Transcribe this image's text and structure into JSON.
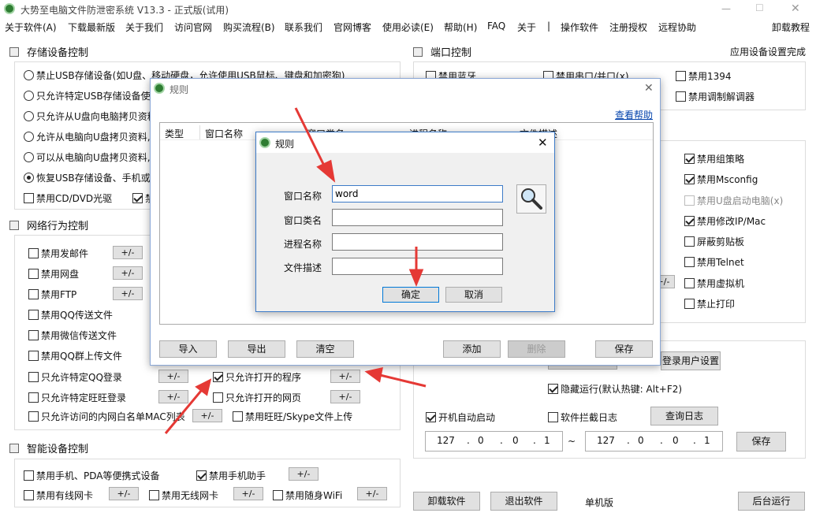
{
  "title": "大势至电脑文件防泄密系统 V13.3 - 正式版(试用)",
  "menu": [
    "关于软件(A)",
    "下载最新版",
    "关于我们",
    "访问官网",
    "购买流程(B)",
    "联系我们",
    "官网博客",
    "使用必读(E)",
    "帮助(H)",
    "FAQ",
    "关于",
    "|",
    "操作软件",
    "注册授权",
    "远程协助"
  ],
  "menu_right": "卸载教程",
  "storage": {
    "title": "存储设备控制",
    "options": [
      "禁止USB存储设备(如U盘、移动硬盘，允许使用USB鼠标、键盘和加密狗)",
      "只允许特定USB存储设备使",
      "只允许从U盘向电脑拷贝资料",
      "允许从电脑向U盘拷贝资料,",
      "可以从电脑向U盘拷贝资料,",
      "恢复USB存储设备、手机或"
    ],
    "cdrom": "禁用CD/DVD光驱",
    "cb2": "禁"
  },
  "network": {
    "title": "网络行为控制",
    "items": [
      "禁用发邮件",
      "禁用网盘",
      "禁用FTP",
      "禁用QQ传送文件",
      "禁用微信传送文件",
      "禁用QQ群上传文件",
      "只允许特定QQ登录",
      "只允许特定旺旺登录",
      "只允许访问的内网白名单MAC列表"
    ],
    "right_items": [
      "只允许打开的程序",
      "只允许打开的网页",
      "禁用旺旺/Skype文件上传"
    ],
    "pm": "+/-"
  },
  "smart": {
    "title": "智能设备控制",
    "items": [
      "禁用手机、PDA等便携式设备",
      "禁用手机助手",
      "禁用有线网卡",
      "禁用无线网卡",
      "禁用随身WiFi"
    ]
  },
  "port": {
    "title": "端口控制",
    "status": "应用设备设置完成",
    "items": [
      "禁用蓝牙",
      "禁用串口/并口(x)",
      "禁用1394",
      "禁用调制解调器"
    ]
  },
  "right_items": [
    "禁用组策略",
    "禁用Msconfig",
    "禁用U盘启动电脑(x)",
    "禁用修改IP/Mac",
    "屏蔽剪贴板",
    "禁用Telnet",
    "禁用虚拟机",
    "禁止打印"
  ],
  "settings": {
    "login_btn": "登录用户设置",
    "hidden": "隐藏运行(默认热键: Alt+F2)",
    "autostart": "开机自动启动",
    "log": "软件拦截日志",
    "query_log": "查询日志",
    "ip1": [
      "127",
      ".",
      "0",
      ".",
      "0",
      ".",
      "1"
    ],
    "tilde": "~",
    "ip2": [
      "127",
      ".",
      "0",
      ".",
      "0",
      ".",
      "1"
    ],
    "save": "保存"
  },
  "bottom": {
    "uninstall": "卸载软件",
    "exit": "退出软件",
    "mode": "单机版",
    "bg": "后台运行"
  },
  "outer_dialog": {
    "title": "规则",
    "help": "查看帮助",
    "cols": [
      "类型",
      "窗口名称",
      "窗口类名",
      "进程名称",
      "文件描述"
    ],
    "import": "导入",
    "export": "导出",
    "clear": "清空",
    "add": "添加",
    "delete": "删除",
    "save": "保存"
  },
  "inner_dialog": {
    "title": "规则",
    "labels": [
      "窗口名称",
      "窗口类名",
      "进程名称",
      "文件描述"
    ],
    "values": [
      "word",
      "",
      "",
      ""
    ],
    "ok": "确定",
    "cancel": "取消"
  }
}
